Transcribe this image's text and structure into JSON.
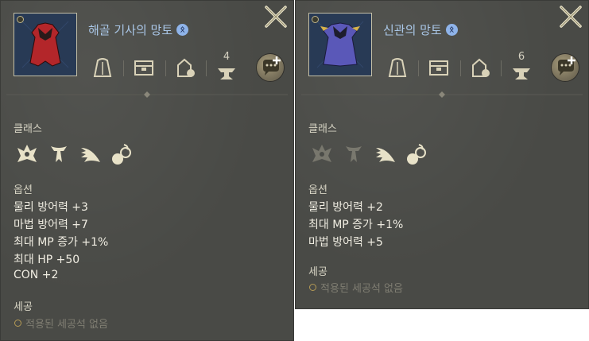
{
  "cards": [
    {
      "item_name": "해골 기사의 망토",
      "enchant_level": "4",
      "class_section_label": "클래스",
      "options_section_label": "옵션",
      "options": [
        "물리 방어력 +3",
        "마법 방어력 +7",
        "최대 MP 증가 +1%",
        "최대 HP +50",
        "CON +2"
      ],
      "socket_section_label": "세공",
      "socket_empty_text": "적용된 세공석 없음",
      "cloak_color": "#b3262a",
      "classes": [
        {
          "icon": "knight-class-icon",
          "usable": true
        },
        {
          "icon": "elf-class-icon",
          "usable": true
        },
        {
          "icon": "wizard-class-icon",
          "usable": true
        },
        {
          "icon": "darkelf-class-icon",
          "usable": true
        }
      ]
    },
    {
      "item_name": "신관의 망토",
      "enchant_level": "6",
      "class_section_label": "클래스",
      "options_section_label": "옵션",
      "options": [
        "물리 방어력 +2",
        "최대 MP 증가 +1%",
        "마법 방어력 +5"
      ],
      "socket_section_label": "세공",
      "socket_empty_text": "적용된 세공석 없음",
      "cloak_color": "#5a58b8",
      "classes": [
        {
          "icon": "knight-class-icon",
          "usable": false
        },
        {
          "icon": "elf-class-icon",
          "usable": false
        },
        {
          "icon": "wizard-class-icon",
          "usable": true
        },
        {
          "icon": "darkelf-class-icon",
          "usable": true
        }
      ]
    }
  ],
  "rune_symbol": "ᛟ",
  "icons": {
    "close": "close-icon",
    "chat_add": "chat-add-icon",
    "stats": [
      "weight-icon",
      "chest-icon",
      "bag-icon",
      "anvil-icon"
    ]
  },
  "colors": {
    "panel_bg": "#494a46",
    "title": "#a9c6e6",
    "option_text": "#f0ede2",
    "icon_gold": "#d9d2b8"
  }
}
